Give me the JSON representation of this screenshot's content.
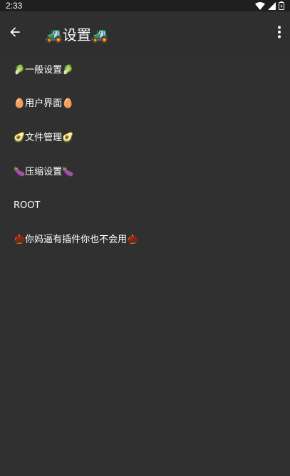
{
  "status_bar": {
    "time": "2:33",
    "icons": [
      "wifi-icon",
      "signal-icon",
      "battery-icon"
    ]
  },
  "app_bar": {
    "back_icon": "arrow-back-icon",
    "title": "🚜设置🚜",
    "more_icon": "more-vert-icon"
  },
  "settings": {
    "items": [
      {
        "label": "🥬一般设置🥬"
      },
      {
        "label": "🥚用户界面🥚"
      },
      {
        "label": "🥑文件管理🥑"
      },
      {
        "label": "🍆压缩设置🍆"
      },
      {
        "label": "ROOT"
      },
      {
        "label": "🌰你妈逼有插件你也不会用🌰"
      }
    ]
  },
  "colors": {
    "background": "#303030",
    "status_bar": "#1f1f1f",
    "text": "#ffffff"
  }
}
